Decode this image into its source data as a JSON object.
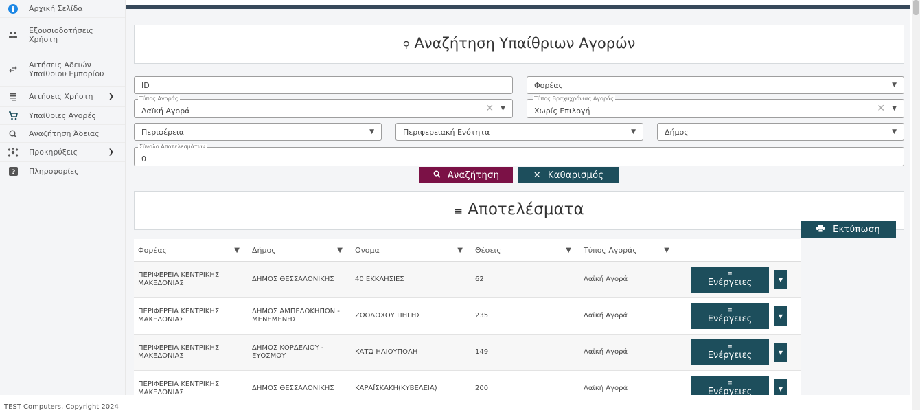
{
  "sidebar": {
    "items": [
      {
        "label": "Αρχική Σελίδα",
        "icon": "info-icon"
      },
      {
        "label": "Εξουσιοδοτήσεις Χρήστη",
        "icon": "users-icon"
      },
      {
        "label": "Αιτήσεις Αδειών Υπαίθριου Εμπορίου",
        "icon": "swap-arrows-icon"
      },
      {
        "label": "Αιτήσεις Χρήστη",
        "icon": "list-icon",
        "expandable": true
      },
      {
        "label": "Υπαίθριες Αγορές",
        "icon": "cart-icon"
      },
      {
        "label": "Αναζήτηση Άδειας",
        "icon": "search-icon"
      },
      {
        "label": "Προκηρύξεις",
        "icon": "network-icon",
        "expandable": true
      },
      {
        "label": "Πληροφορίες",
        "icon": "question-icon"
      }
    ]
  },
  "search": {
    "title": "Αναζήτηση Υπαίθριων Αγορών",
    "id_placeholder": "ID",
    "foreas_placeholder": "Φορέας",
    "market_type_label": "Τύπος Αγοράς",
    "market_type_value": "Λαϊκή Αγορά",
    "short_market_type_label": "Τύπος Βραχυχρόνιας Αγοράς",
    "short_market_type_value": "Χωρίς Επιλογή",
    "region_placeholder": "Περιφέρεια",
    "regional_unit_placeholder": "Περιφερειακή Ενότητα",
    "municipality_placeholder": "Δήμος",
    "total_results_label": "Σύνολο Αποτελεσμάτων",
    "total_results_value": "0",
    "search_button": "Αναζήτηση",
    "clear_button": "Καθαρισμός"
  },
  "results": {
    "title": "Αποτελέσματα",
    "print_button": "Εκτύπωση",
    "columns": [
      "Φορέας",
      "Δήμος",
      "Ονομα",
      "Θέσεις",
      "Τύπος Αγοράς"
    ],
    "action_label": "Ενέργειες",
    "rows": [
      {
        "foreas": "ΠΕΡΙΦΕΡΕΙΑ ΚΕΝΤΡΙΚΗΣ ΜΑΚΕΔΟΝΙΑΣ",
        "dimos": "ΔΗΜΟΣ ΘΕΣΣΑΛΟΝΙΚΗΣ",
        "onoma": "40 ΕΚΚΛΗΣΙΕΣ",
        "theseis": "62",
        "typos": "Λαϊκή Αγορά"
      },
      {
        "foreas": "ΠΕΡΙΦΕΡΕΙΑ ΚΕΝΤΡΙΚΗΣ ΜΑΚΕΔΟΝΙΑΣ",
        "dimos": "ΔΗΜΟΣ ΑΜΠΕΛΟΚΗΠΩΝ - ΜΕΝΕΜΕΝΗΣ",
        "onoma": "ΖΩΟΔΟΧΟΥ ΠΗΓΗΣ",
        "theseis": "235",
        "typos": "Λαϊκή Αγορά"
      },
      {
        "foreas": "ΠΕΡΙΦΕΡΕΙΑ ΚΕΝΤΡΙΚΗΣ ΜΑΚΕΔΟΝΙΑΣ",
        "dimos": "ΔΗΜΟΣ ΚΟΡΔΕΛΙΟΥ - ΕΥΟΣΜΟΥ",
        "onoma": "ΚΑΤΩ ΗΛΙΟΥΠΟΛΗ",
        "theseis": "149",
        "typos": "Λαϊκή Αγορά"
      },
      {
        "foreas": "ΠΕΡΙΦΕΡΕΙΑ ΚΕΝΤΡΙΚΗΣ ΜΑΚΕΔΟΝΙΑΣ",
        "dimos": "ΔΗΜΟΣ ΘΕΣΣΑΛΟΝΙΚΗΣ",
        "onoma": "ΚΑΡΑΪΣΚΑΚΗ(ΚΥΒΕΛΕΙΑ)",
        "theseis": "200",
        "typos": "Λαϊκή Αγορά"
      }
    ]
  },
  "footer": {
    "text": "TEST Computers, Copyright 2024"
  },
  "colors": {
    "accent_search": "#7b1146",
    "accent_primary": "#1d4e5c",
    "topbar": "#37495a"
  }
}
